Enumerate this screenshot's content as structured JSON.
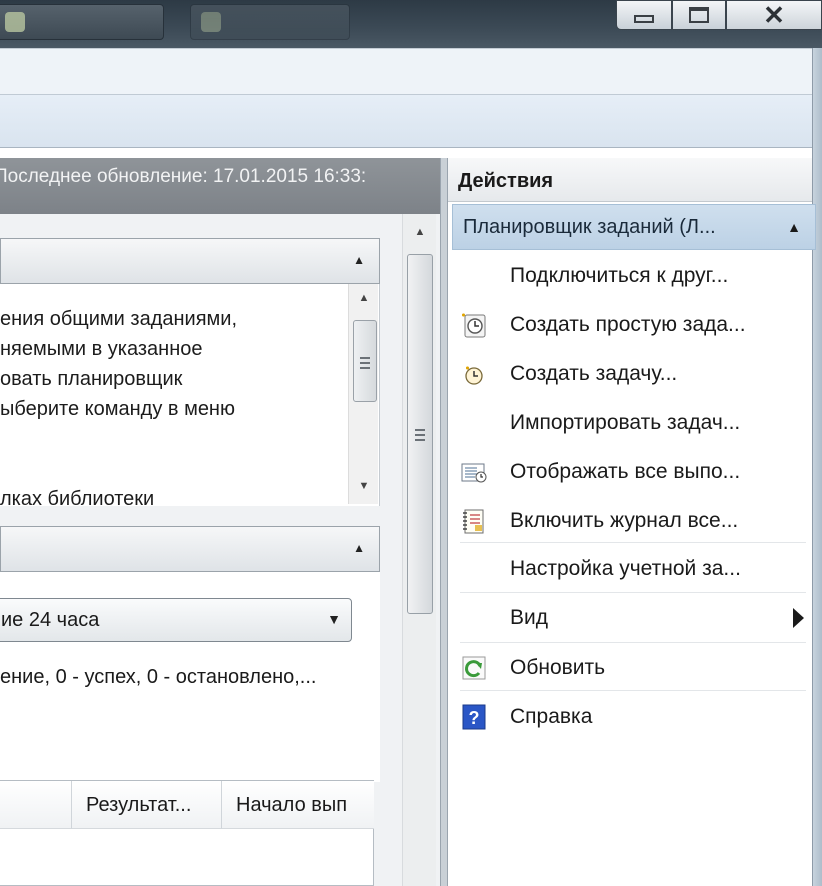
{
  "window": {
    "controls": [
      "minimize",
      "maximize",
      "close"
    ]
  },
  "left": {
    "last_update": "Последнее обновление: 17.01.2015 16:33:",
    "description_lines": [
      "ения общими заданиями,",
      "няемыми в указанное",
      "овать планировщик",
      "ыберите команду в меню",
      "",
      "лках библиотеки"
    ],
    "dropdown_value": "ие 24 часа",
    "stats_text": "ение, 0 - успех, 0 - остановлено,...",
    "table_headers": [
      "",
      "Результат...",
      "Начало вып"
    ]
  },
  "actions": {
    "title": "Действия",
    "section": "Планировщик заданий (Л...",
    "items": [
      {
        "label": "Подключиться к друг...",
        "icon": "none"
      },
      {
        "label": "Создать простую зада...",
        "icon": "create-basic-task-icon"
      },
      {
        "label": "Создать задачу...",
        "icon": "create-task-icon"
      },
      {
        "label": "Импортировать задач...",
        "icon": "none"
      },
      {
        "label": "Отображать все выпо...",
        "icon": "display-running-tasks-icon"
      },
      {
        "label": "Включить журнал все...",
        "icon": "enable-history-icon"
      },
      {
        "label": "Настройка учетной за...",
        "icon": "none"
      },
      {
        "label": "Вид",
        "icon": "none"
      },
      {
        "label": "Обновить",
        "icon": "refresh-icon"
      },
      {
        "label": "Справка",
        "icon": "help-icon"
      }
    ]
  },
  "colors": {
    "section_bg": "#c6d8ea",
    "refresh_green": "#3a9a3a",
    "help_blue": "#2a56c6"
  }
}
